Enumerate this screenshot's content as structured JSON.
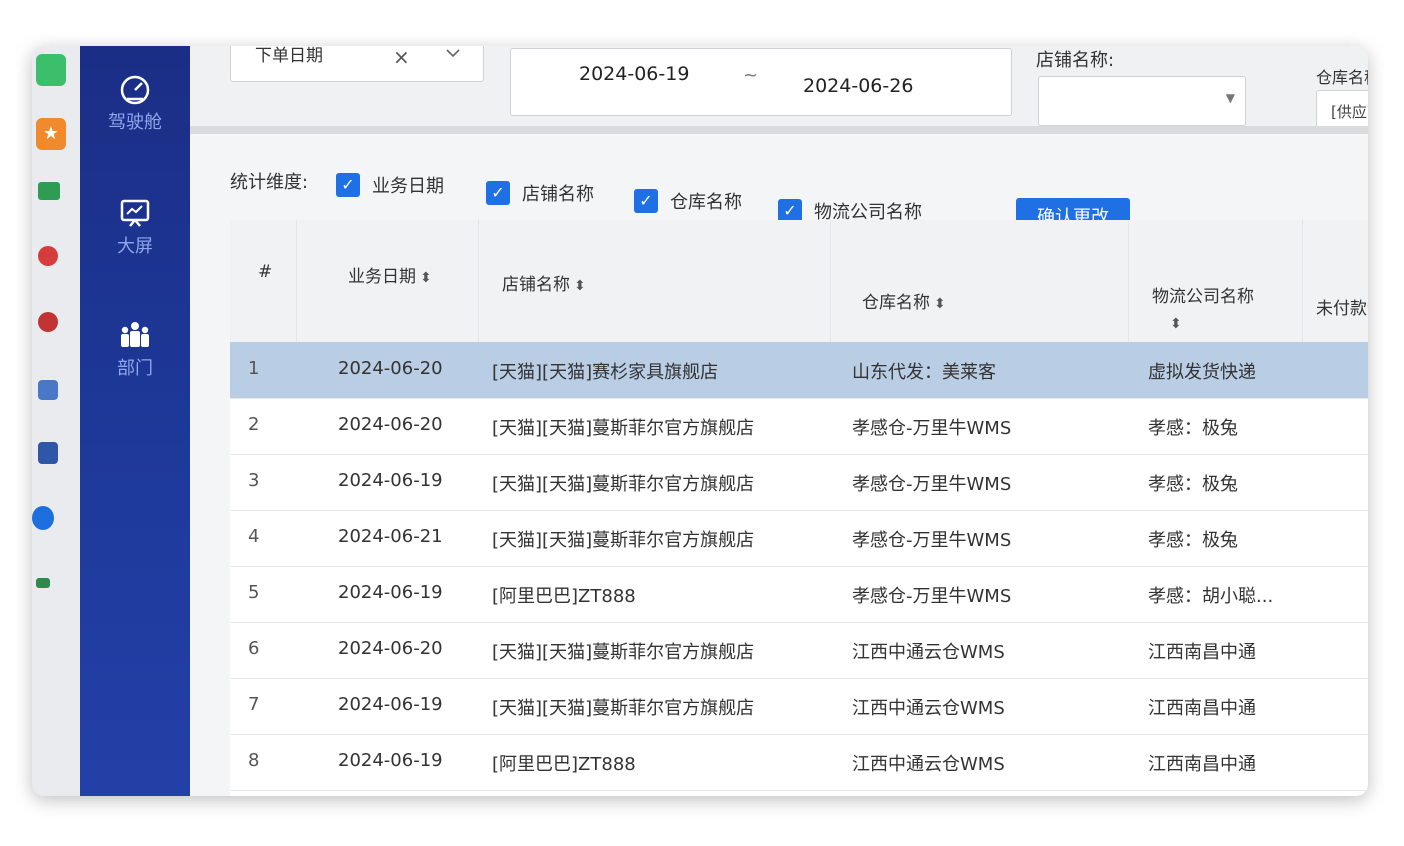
{
  "sidebar": {
    "items": [
      {
        "label": "驾驶舱",
        "icon": "dashboard-gauge-icon"
      },
      {
        "label": "大屏",
        "icon": "presentation-screen-icon"
      },
      {
        "label": "部门",
        "icon": "department-people-icon"
      }
    ]
  },
  "filters": {
    "date_type_value": "下单日期",
    "clear_symbol": "×",
    "start_date": "2024-06-19",
    "range_separator": "~",
    "end_date": "2024-06-26",
    "store_label": "店铺名称:",
    "store_value": "",
    "warehouse_label": "仓库名称:",
    "warehouse_value": "[供应商]"
  },
  "dimensions": {
    "title": "统计维度:",
    "options": [
      {
        "label": "业务日期",
        "checked": true
      },
      {
        "label": "店铺名称",
        "checked": true
      },
      {
        "label": "仓库名称",
        "checked": true
      },
      {
        "label": "物流公司名称",
        "checked": true
      }
    ],
    "confirm_label": "确认更改"
  },
  "table": {
    "headers": [
      "#",
      "业务日期",
      "店铺名称",
      "仓库名称",
      "物流公司名称",
      "未付款订"
    ],
    "rows": [
      {
        "n": "1",
        "date": "2024-06-20",
        "store": "[天猫][天猫]赛杉家具旗舰店",
        "warehouse": "山东代发：美莱客",
        "logistics": "虚拟发货快递",
        "selected": true
      },
      {
        "n": "2",
        "date": "2024-06-20",
        "store": "[天猫][天猫]蔓斯菲尔官方旗舰店",
        "warehouse": "孝感仓-万里牛WMS",
        "logistics": "孝感：极兔"
      },
      {
        "n": "3",
        "date": "2024-06-19",
        "store": "[天猫][天猫]蔓斯菲尔官方旗舰店",
        "warehouse": "孝感仓-万里牛WMS",
        "logistics": "孝感：极兔"
      },
      {
        "n": "4",
        "date": "2024-06-21",
        "store": "[天猫][天猫]蔓斯菲尔官方旗舰店",
        "warehouse": "孝感仓-万里牛WMS",
        "logistics": "孝感：极兔"
      },
      {
        "n": "5",
        "date": "2024-06-19",
        "store": "[阿里巴巴]ZT888",
        "warehouse": "孝感仓-万里牛WMS",
        "logistics": "孝感：胡小聪..."
      },
      {
        "n": "6",
        "date": "2024-06-20",
        "store": "[天猫][天猫]蔓斯菲尔官方旗舰店",
        "warehouse": "江西中通云仓WMS",
        "logistics": "江西南昌中通"
      },
      {
        "n": "7",
        "date": "2024-06-19",
        "store": "[天猫][天猫]蔓斯菲尔官方旗舰店",
        "warehouse": "江西中通云仓WMS",
        "logistics": "江西南昌中通"
      },
      {
        "n": "8",
        "date": "2024-06-19",
        "store": "[阿里巴巴]ZT888",
        "warehouse": "江西中通云仓WMS",
        "logistics": "江西南昌中通"
      }
    ]
  },
  "colors": {
    "sidebar": "#1e3a9c",
    "accent": "#1f6fe5",
    "selected_row": "#b9cde4"
  }
}
